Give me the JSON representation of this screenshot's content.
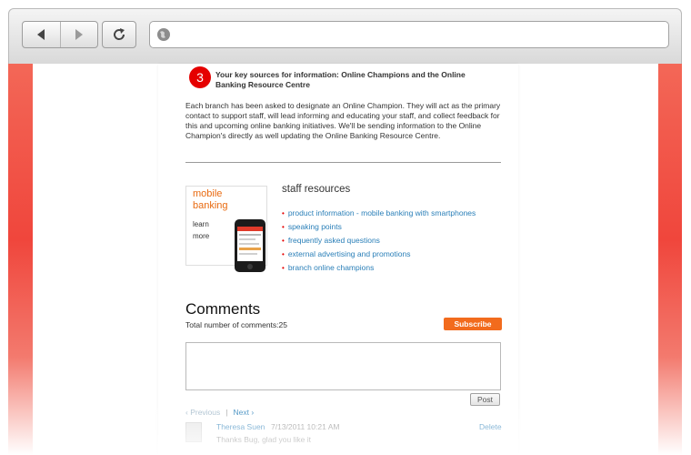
{
  "browser": {
    "address_value": "",
    "icons": {
      "back": "back-arrow-icon",
      "forward": "forward-arrow-icon",
      "reload": "reload-icon",
      "site": "globe-icon"
    }
  },
  "section": {
    "step_number": "3",
    "title": "Your key sources for information: Online Champions and the Online Banking Resource Centre",
    "body": "Each branch has been asked to designate an Online Champion. They will act as the primary contact to support staff, will lead informing and educating your staff, and collect feedback for this and upcoming online banking initiatives. We'll be sending information to the Online Champion's directly as well updating the Online Banking Resource Centre."
  },
  "promo": {
    "title_line1": "mobile",
    "title_line2": "banking",
    "link_line1": "learn",
    "link_line2": "more"
  },
  "resources": {
    "title": "staff resources",
    "items": [
      "product information - mobile banking with smartphones",
      "speaking points",
      "frequently asked questions",
      "external advertising and promotions",
      "branch online champions"
    ]
  },
  "comments": {
    "heading": "Comments",
    "count_text": "Total number of comments:25",
    "subscribe_label": "Subscribe",
    "box_placeholder": "",
    "post_label": "Post",
    "pager": {
      "previous": "‹ Previous",
      "separator": "|",
      "next": "Next ›"
    },
    "first_comment": {
      "author": "Theresa Suen",
      "timestamp": "7/13/2011 10:21 AM",
      "delete_label": "Delete",
      "text": "Thanks Bug, glad you like it"
    }
  },
  "colors": {
    "accent_red": "#e50000",
    "frame_red": "#f0463c",
    "orange": "#f26b1d",
    "link_blue": "#2a7fb8"
  }
}
